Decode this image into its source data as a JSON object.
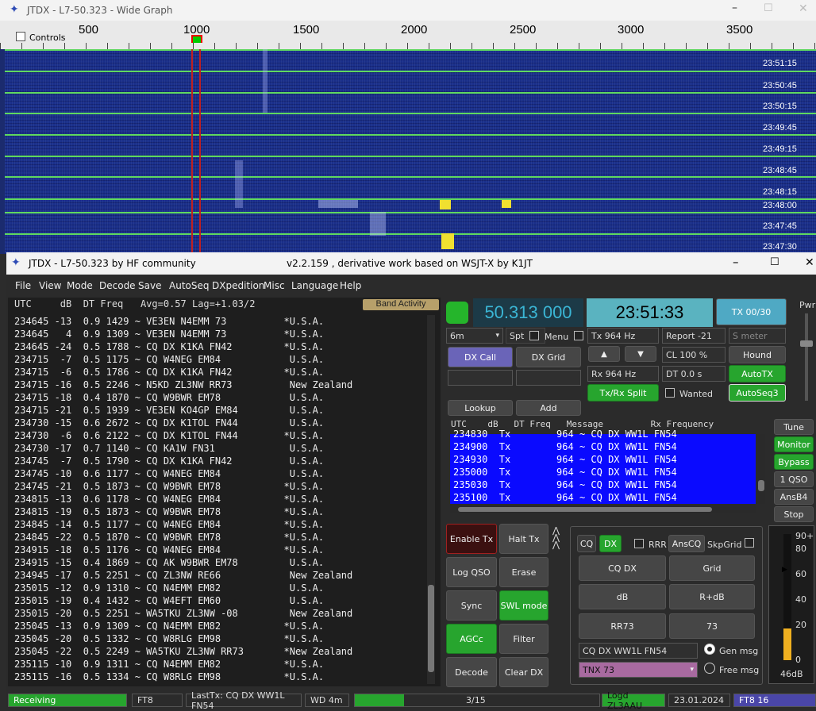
{
  "wide_graph": {
    "title": "JTDX - L7-50.323 - Wide Graph",
    "controls_label": "Controls",
    "scale_labels": [
      "500",
      "1000",
      "1500",
      "2000",
      "2500",
      "3000",
      "3500"
    ],
    "timestamps": [
      "23:51:15",
      "23:50:45",
      "23:50:15",
      "23:49:45",
      "23:49:15",
      "23:48:45",
      "23:48:15",
      "23:48:00",
      "23:47:45",
      "23:47:30"
    ],
    "band": "6m"
  },
  "main": {
    "title": "JTDX - L7-50.323  by HF community",
    "version": "v2.2.159 , derivative work based on WSJT-X by K1JT",
    "menu": [
      "File",
      "View",
      "Mode",
      "Decode",
      "Save",
      "AutoSeq",
      "DXpedition",
      "Misc",
      "Language",
      "Help"
    ],
    "decode_header": "UTC     dB  DT Freq   Avg=0.57 Lag=+1.03/2",
    "band_activity": "Band Activity",
    "decodes": [
      "234645 -13  0.9 1429 ~ VE3EN N4EMM 73          *U.S.A.",
      "234645   4  0.9 1309 ~ VE3EN N4EMM 73          *U.S.A.",
      "234645 -24  0.5 1788 ~ CQ DX K1KA FN42         *U.S.A.",
      "234715  -7  0.5 1175 ~ CQ W4NEG EM84            U.S.A.",
      "234715  -6  0.5 1786 ~ CQ DX K1KA FN42         *U.S.A.",
      "234715 -16  0.5 2246 ~ N5KD ZL3NW RR73          New Zealand",
      "234715 -18  0.4 1870 ~ CQ W9BWR EM78            U.S.A.",
      "234715 -21  0.5 1939 ~ VE3EN KO4GP EM84         U.S.A.",
      "234730 -15  0.6 2672 ~ CQ DX K1TOL FN44         U.S.A.",
      "234730  -6  0.6 2122 ~ CQ DX K1TOL FN44        *U.S.A.",
      "234730 -17  0.7 1140 ~ CQ KA1W FN31             U.S.A.",
      "234745  -7  0.5 1790 ~ CQ DX K1KA FN42          U.S.A.",
      "234745 -10  0.6 1177 ~ CQ W4NEG EM84            U.S.A.",
      "234745 -21  0.5 1873 ~ CQ W9BWR EM78           *U.S.A.",
      "234815 -13  0.6 1178 ~ CQ W4NEG EM84           *U.S.A.",
      "234815 -19  0.5 1873 ~ CQ W9BWR EM78           *U.S.A.",
      "234845 -14  0.5 1177 ~ CQ W4NEG EM84           *U.S.A.",
      "234845 -22  0.5 1870 ~ CQ W9BWR EM78           *U.S.A.",
      "234915 -18  0.5 1176 ~ CQ W4NEG EM84           *U.S.A.",
      "234915 -15  0.4 1869 ~ CQ AK W9BWR EM78         U.S.A.",
      "234945 -17  0.5 2251 ~ CQ ZL3NW RE66            New Zealand",
      "235015 -12  0.9 1310 ~ CQ N4EMM EM82            U.S.A.",
      "235015 -19  0.4 1432 ~ CQ W4EFT EM60            U.S.A.",
      "235015 -20  0.5 2251 ~ WA5TKU ZL3NW -08         New Zealand",
      "235045 -13  0.9 1309 ~ CQ N4EMM EM82           *U.S.A.",
      "235045 -20  0.5 1332 ~ CQ W8RLG EM98           *U.S.A.",
      "235045 -22  0.5 2249 ~ WA5TKU ZL3NW RR73       *New Zealand",
      "235115 -10  0.9 1311 ~ CQ N4EMM EM82           *U.S.A.",
      "235115 -16  0.5 1334 ~ CQ W8RLG EM98           *U.S.A."
    ],
    "frequency": "50.313 000",
    "clock": "23:51:33",
    "tx_count": "TX 00/30",
    "pwr_label": "Pwr",
    "band_select": "6m",
    "spt": "Spt",
    "menu_chk": "Menu",
    "tx_freq": "Tx  964  Hz",
    "rx_freq": "Rx  964  Hz",
    "report": "Report -21",
    "s_meter": "S meter",
    "cl": "CL  100 %",
    "dt": "DT 0.0 s",
    "dx_call_btn": "DX Call",
    "dx_grid_btn": "DX Grid",
    "hound": "Hound",
    "autotx": "AutoTX",
    "txrx_split": "Tx/Rx Split",
    "wanted": "Wanted",
    "autoseq3": "AutoSeq3",
    "lookup": "Lookup",
    "add": "Add",
    "up": "▲",
    "down": "▼",
    "txlog_header": "UTC    dB   DT Freq   Message         Rx Frequency",
    "txlog": [
      "234830  Tx        964 ~ CQ DX WW1L FN54",
      "234900  Tx        964 ~ CQ DX WW1L FN54",
      "234930  Tx        964 ~ CQ DX WW1L FN54",
      "235000  Tx        964 ~ CQ DX WW1L FN54",
      "235030  Tx        964 ~ CQ DX WW1L FN54",
      "235100  Tx        964 ~ CQ DX WW1L FN54"
    ],
    "side_buttons": [
      "Tune",
      "Monitor",
      "Bypass",
      "1 QSO",
      "AnsB4",
      "Stop"
    ],
    "left_buttons": [
      "Enable Tx",
      "Halt Tx",
      "Log QSO",
      "Erase",
      "Sync",
      "SWL mode",
      "AGCc",
      "Filter",
      "Decode",
      "Clear DX"
    ],
    "ctrl": {
      "cq": "CQ",
      "dx": "DX",
      "rrr": "RRR",
      "anscq": "AnsCQ",
      "skpgrid": "SkpGrid"
    },
    "msg_buttons": [
      "CQ DX",
      "Grid",
      "dB",
      "R+dB",
      "RR73",
      "73"
    ],
    "gen_msg_text": "CQ DX WW1L FN54",
    "gen_msg": "Gen msg",
    "free_msg_text": "TNX 73",
    "free_msg": "Free msg",
    "meter_ticks": [
      "90+",
      "80",
      "60",
      "40",
      "20",
      "0"
    ],
    "meter_db": "46dB",
    "meter_level": 0.46,
    "status": {
      "receiving": "Receiving",
      "mode": "FT8",
      "last_tx": "LastTx: CQ DX WW1L FN54",
      "wd": "WD 4m",
      "progress": "3/15",
      "progress_frac": 0.2,
      "logd": "Logd ZL3AAU",
      "date": "23.01.2024",
      "mode2": "FT8  16"
    }
  }
}
